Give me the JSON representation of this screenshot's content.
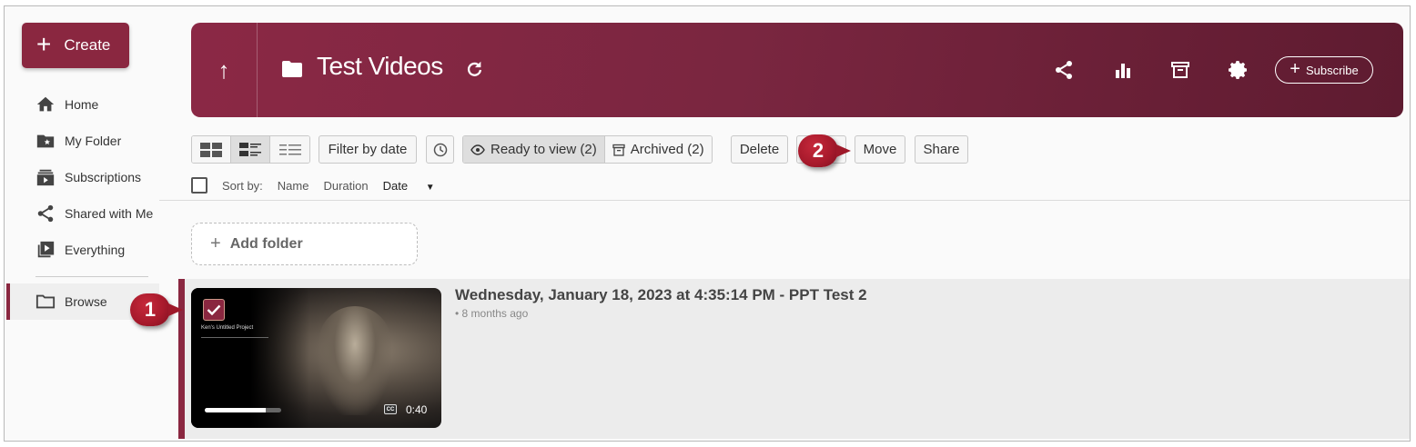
{
  "sidebar": {
    "create_label": "Create",
    "items": [
      {
        "label": "Home",
        "icon": "home-icon"
      },
      {
        "label": "My Folder",
        "icon": "star-folder-icon"
      },
      {
        "label": "Subscriptions",
        "icon": "subscriptions-icon"
      },
      {
        "label": "Shared with Me",
        "icon": "share-icon"
      },
      {
        "label": "Everything",
        "icon": "play-library-icon"
      }
    ],
    "browse_label": "Browse"
  },
  "header": {
    "title": "Test Videos",
    "subscribe_label": "Subscribe",
    "brand_color": "#8a2740"
  },
  "toolbar": {
    "filter_by_date": "Filter by date",
    "ready_to_view": "Ready to view (2)",
    "archived": "Archived (2)",
    "delete": "Delete",
    "move": "Move",
    "share": "Share"
  },
  "sort": {
    "label": "Sort by:",
    "name": "Name",
    "duration": "Duration",
    "date": "Date"
  },
  "add_folder_label": "Add folder",
  "session": {
    "title": "Wednesday, January 18, 2023 at 4:35:14 PM - PPT Test 2",
    "meta": "• 8 months ago",
    "thumbnail_caption": "Ken's Untitled Project",
    "duration": "0:40",
    "cc_label": "CC",
    "progress_percent": 80,
    "selected": true
  },
  "callouts": {
    "one": "1",
    "two": "2"
  }
}
